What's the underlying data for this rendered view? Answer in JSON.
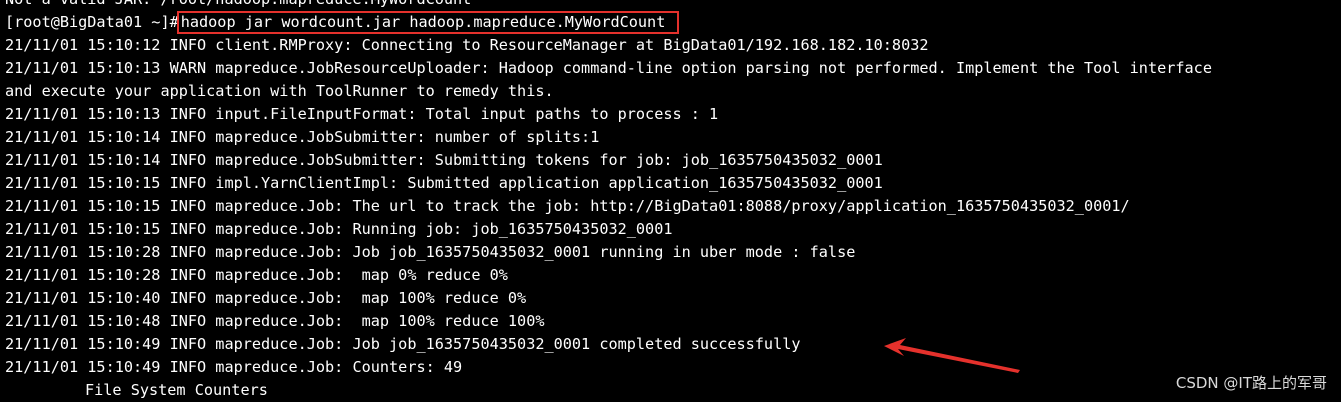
{
  "terminal": {
    "top_line": "Not a valid JAR: /root/hadoop.mapreduce.MyWordCount",
    "prompt": "[root@BigData01 ~]#",
    "command": "hadoop jar wordcount.jar hadoop.mapreduce.MyWordCount",
    "lines": [
      "21/11/01 15:10:12 INFO client.RMProxy: Connecting to ResourceManager at BigData01/192.168.182.10:8032",
      "21/11/01 15:10:13 WARN mapreduce.JobResourceUploader: Hadoop command-line option parsing not performed. Implement the Tool interface",
      "and execute your application with ToolRunner to remedy this.",
      "21/11/01 15:10:13 INFO input.FileInputFormat: Total input paths to process : 1",
      "21/11/01 15:10:14 INFO mapreduce.JobSubmitter: number of splits:1",
      "21/11/01 15:10:14 INFO mapreduce.JobSubmitter: Submitting tokens for job: job_1635750435032_0001",
      "21/11/01 15:10:15 INFO impl.YarnClientImpl: Submitted application application_1635750435032_0001",
      "21/11/01 15:10:15 INFO mapreduce.Job: The url to track the job: http://BigData01:8088/proxy/application_1635750435032_0001/",
      "21/11/01 15:10:15 INFO mapreduce.Job: Running job: job_1635750435032_0001",
      "21/11/01 15:10:28 INFO mapreduce.Job: Job job_1635750435032_0001 running in uber mode : false",
      "21/11/01 15:10:28 INFO mapreduce.Job:  map 0% reduce 0%",
      "21/11/01 15:10:40 INFO mapreduce.Job:  map 100% reduce 0%",
      "21/11/01 15:10:48 INFO mapreduce.Job:  map 100% reduce 100%",
      "21/11/01 15:10:49 INFO mapreduce.Job: Job job_1635750435032_0001 completed successfully",
      "21/11/01 15:10:49 INFO mapreduce.Job: Counters: 49"
    ],
    "last_line": "File System Counters"
  },
  "annotation": {
    "highlight_color": "#e5312c",
    "arrow_color": "#e5312c",
    "arrow_icon": "arrow-pointer-icon"
  },
  "watermark": "CSDN @IT路上的军哥"
}
